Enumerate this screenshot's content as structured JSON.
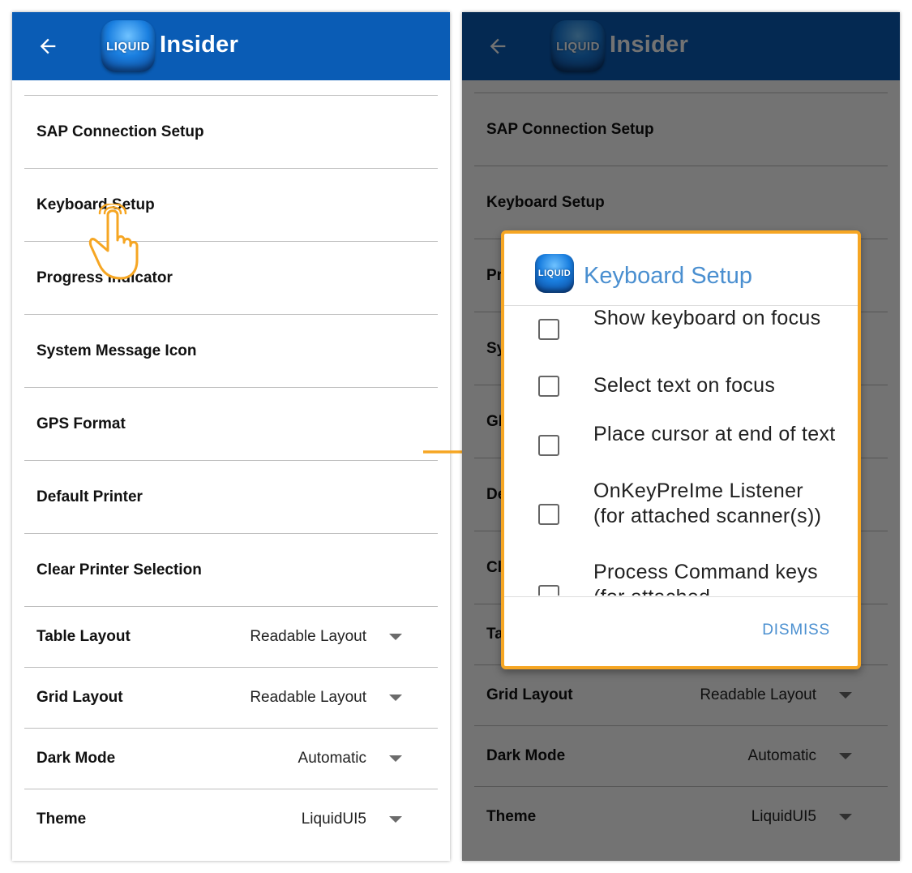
{
  "app": {
    "logo_text": "LIQUID",
    "brand": "Insider"
  },
  "menu_items": [
    {
      "label": "SAP Connection Setup"
    },
    {
      "label": "Keyboard Setup"
    },
    {
      "label": "Progress Indicator"
    },
    {
      "label": "System Message Icon"
    },
    {
      "label": "GPS Format"
    },
    {
      "label": "Default Printer"
    },
    {
      "label": "Clear Printer Selection"
    }
  ],
  "settings": [
    {
      "label": "Table Layout",
      "value": "Readable Layout"
    },
    {
      "label": "Grid Layout",
      "value": "Readable Layout"
    },
    {
      "label": "Dark Mode",
      "value": "Automatic"
    },
    {
      "label": "Theme",
      "value": "LiquidUI5"
    }
  ],
  "dialog": {
    "title": "Keyboard Setup",
    "options": [
      {
        "label": "Show keyboard on focus",
        "checked": false
      },
      {
        "label": "Select text on focus",
        "checked": false
      },
      {
        "label": "Place cursor at end of text",
        "checked": false
      },
      {
        "label": "OnKeyPreIme Listener (for attached scanner(s))",
        "checked": false
      },
      {
        "label": "Process Command keys (for attached",
        "checked": false
      }
    ],
    "dismiss_label": "DISMISS"
  },
  "colors": {
    "appbar": "#0a5cb5",
    "accent": "#4a8fd0",
    "highlight": "#f6a623"
  },
  "icons": {
    "back": "arrow-left-icon",
    "pointer": "hand-pointer-icon",
    "flow": "arrow-right-icon"
  }
}
